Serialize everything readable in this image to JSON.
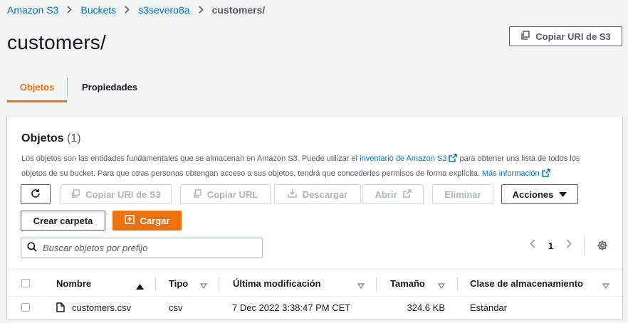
{
  "breadcrumb": [
    "Amazon S3",
    "Buckets",
    "s3severo8a",
    "customers/"
  ],
  "page_title": "customers/",
  "copy_uri_top": "Copiar URI de S3",
  "tabs": [
    {
      "label": "Objetos",
      "active": true
    },
    {
      "label": "Propiedades",
      "active": false
    }
  ],
  "panel": {
    "title": "Objetos",
    "count": "(1)",
    "desc_1": "Los objetos son las entidades fundamentales que se almacenan en Amazon S3. Puede utilizar el ",
    "desc_link_1": "inventario de Amazon S3",
    "desc_2": " para obtener una lista de todos los objetos de su bucket. Para que otras personas obtengan acceso a sus objetos, tendrá que concederles permisos de forma explícita. ",
    "desc_link_2": "Más información"
  },
  "toolbar": {
    "copy_uri": "Copiar URI de S3",
    "copy_url": "Copiar URL",
    "download": "Descargar",
    "open": "Abrir",
    "delete": "Eliminar",
    "actions": "Acciones",
    "create_folder": "Crear carpeta",
    "upload": "Cargar"
  },
  "search": {
    "placeholder": "Buscar objetos por prefijo"
  },
  "pagination": {
    "page": "1"
  },
  "table": {
    "columns": [
      "Nombre",
      "Tipo",
      "Última modificación",
      "Tamaño",
      "Clase de almacenamiento"
    ],
    "rows": [
      {
        "name": "customers.csv",
        "type": "csv",
        "modified": "7 Dec 2022 3:38:47 PM CET",
        "size": "324.6 KB",
        "storage_class": "Estándar"
      }
    ]
  },
  "colors": {
    "accent": "#ec7211",
    "link": "#0073bb",
    "text": "#16191f",
    "muted": "#545b64"
  }
}
